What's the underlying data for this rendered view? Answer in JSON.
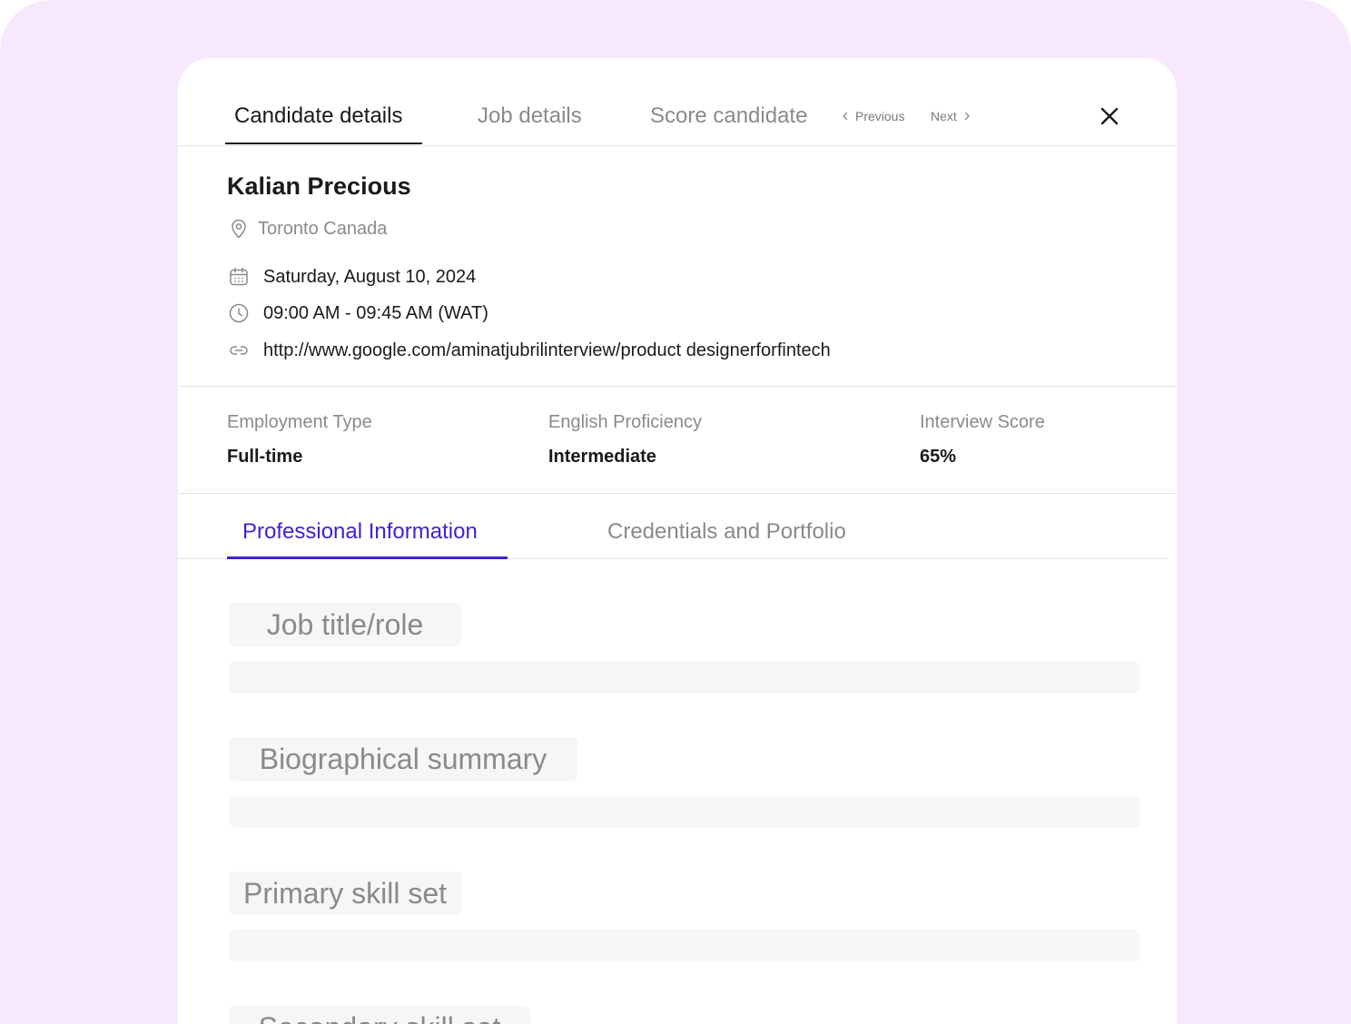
{
  "tabs": {
    "candidate_details": "Candidate details",
    "job_details": "Job details",
    "score_candidate": "Score candidate",
    "previous": "Previous",
    "next": "Next"
  },
  "candidate": {
    "name": "Kalian Precious",
    "location": "Toronto Canada",
    "date": "Saturday, August 10, 2024",
    "time": "09:00 AM - 09:45 AM (WAT)",
    "link": "http://www.google.com/aminatjubrilinterview/product designerforfintech"
  },
  "stats": {
    "employment_type": {
      "label": "Employment Type",
      "value": "Full-time"
    },
    "english_proficiency": {
      "label": "English Proficiency",
      "value": "Intermediate"
    },
    "interview_score": {
      "label": "Interview Score",
      "value": "65%"
    }
  },
  "subtabs": {
    "professional": "Professional Information",
    "credentials": "Credentials and Portfolio"
  },
  "fields": {
    "job_title": "Job title/role",
    "bio": "Biographical summary",
    "primary_skills": "Primary skill set",
    "secondary_skills": "Secondary skill set"
  },
  "colors": {
    "background": "#f7e8fd",
    "accent": "#3b23d6",
    "text": "#1a1a1a",
    "muted": "#8a8a8a"
  },
  "icons": [
    "chevron-left-icon",
    "chevron-right-icon",
    "close-icon",
    "location-pin-icon",
    "calendar-icon",
    "clock-icon",
    "link-icon"
  ]
}
